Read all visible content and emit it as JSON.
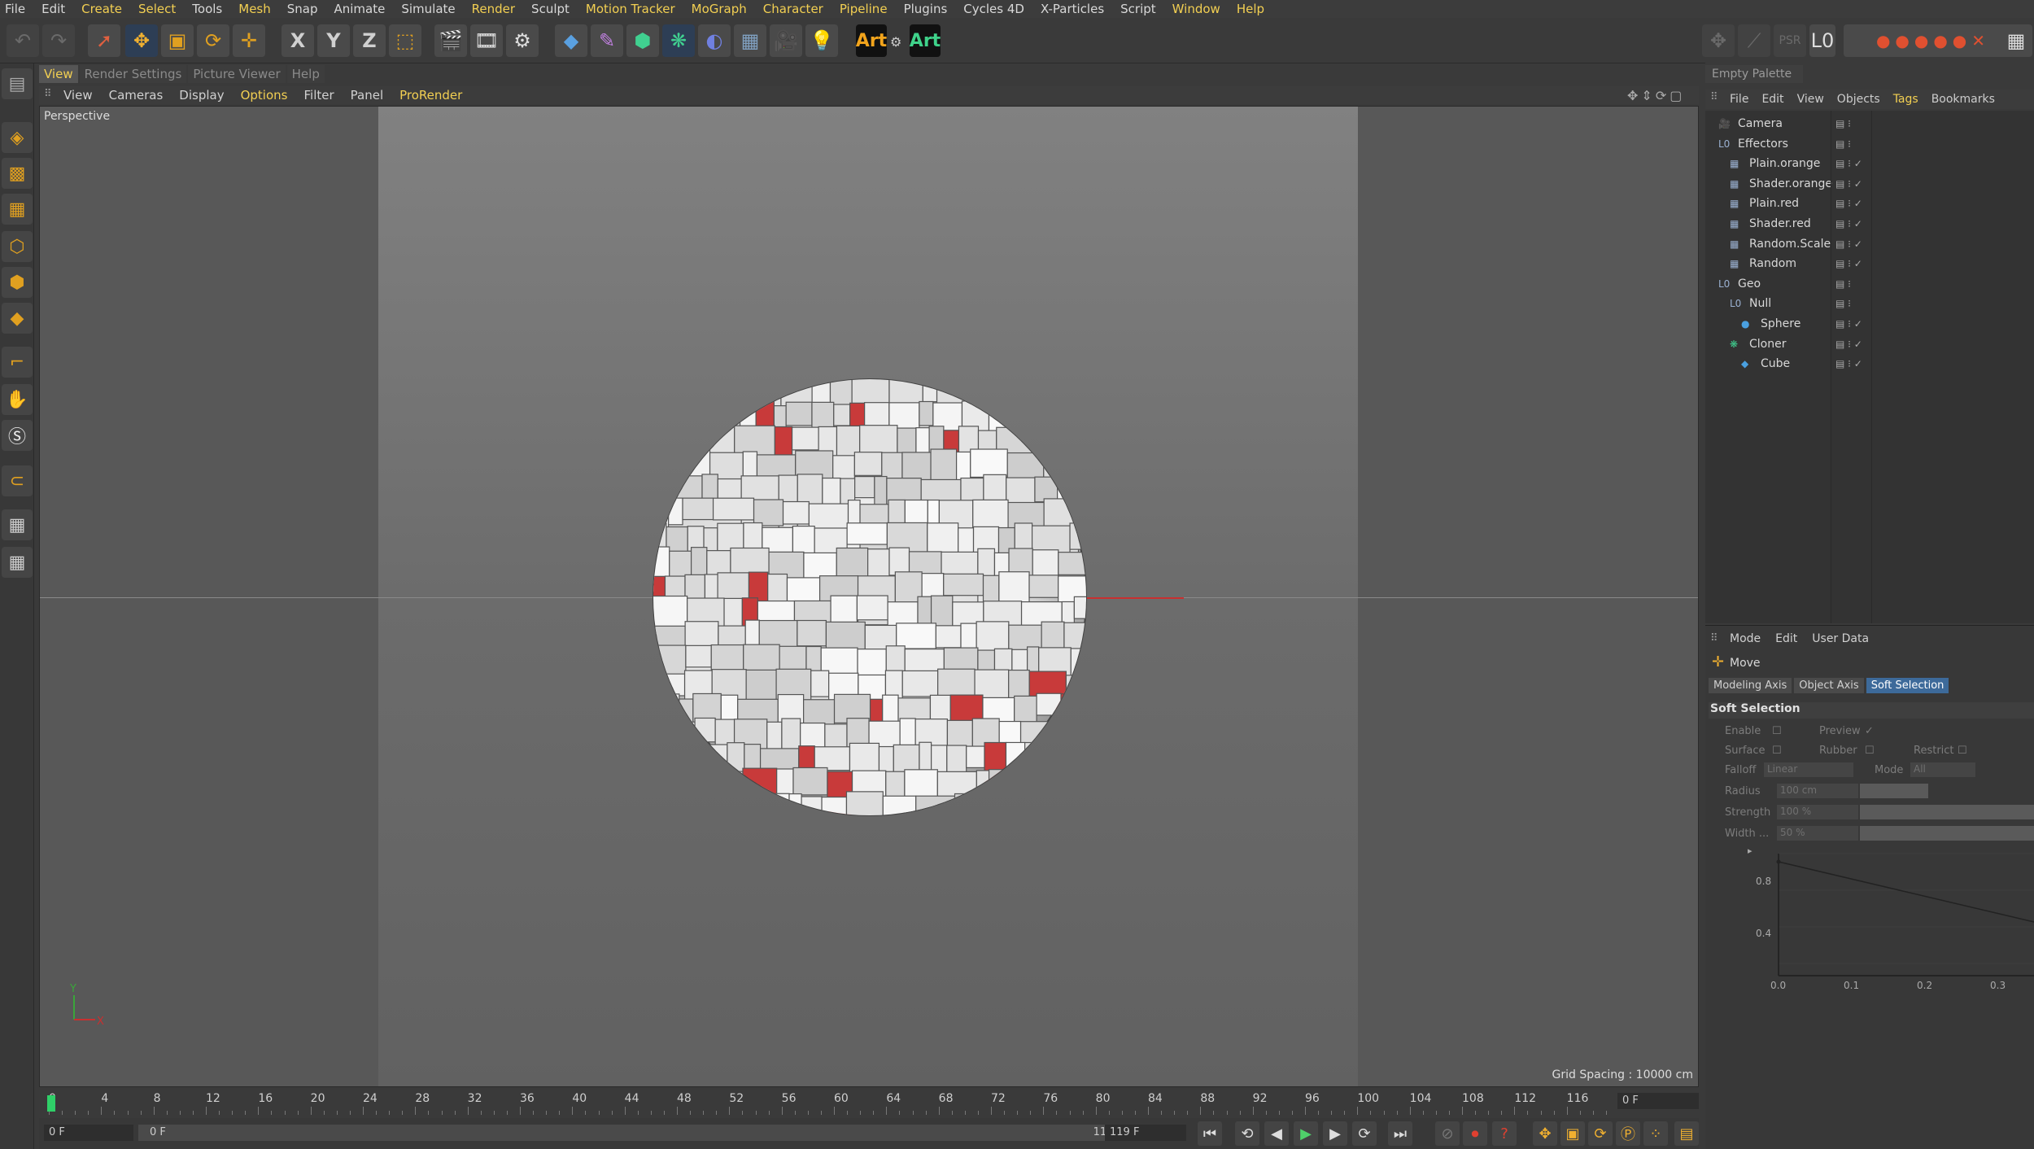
{
  "menubar": [
    "File",
    "Edit",
    "Create",
    "Select",
    "Tools",
    "Mesh",
    "Snap",
    "Animate",
    "Simulate",
    "Render",
    "Sculpt",
    "Motion Tracker",
    "MoGraph",
    "Character",
    "Pipeline",
    "Plugins",
    "Cycles 4D",
    "X-Particles",
    "Script",
    "Window",
    "Help"
  ],
  "menubar_highlight": [
    "Create",
    "Select",
    "Mesh",
    "Render",
    "Motion Tracker",
    "MoGraph",
    "Character",
    "Pipeline",
    "Window",
    "Help"
  ],
  "toolbar": {
    "x_label": "X",
    "y_label": "Y",
    "z_label": "Z",
    "art1": "Art",
    "art2": "Art"
  },
  "viewport_tabs": [
    "View",
    "Render Settings",
    "Picture Viewer",
    "Help"
  ],
  "viewport_menu": [
    "View",
    "Cameras",
    "Display",
    "Options",
    "Filter",
    "Panel",
    "ProRender"
  ],
  "viewport": {
    "label": "Perspective",
    "grid_spacing": "Grid Spacing : 10000 cm",
    "axis_y": "Y",
    "axis_x": "X"
  },
  "timeline": {
    "ticks": [
      "0",
      "4",
      "8",
      "12",
      "16",
      "20",
      "24",
      "28",
      "32",
      "36",
      "40",
      "44",
      "48",
      "52",
      "56",
      "60",
      "64",
      "68",
      "72",
      "76",
      "80",
      "84",
      "88",
      "92",
      "96",
      "100",
      "104",
      "108",
      "112",
      "116"
    ],
    "current_frame": "0 F"
  },
  "transport": {
    "start": "0 F",
    "range_start": "0 F",
    "range_end": "119 F",
    "end": "119 F"
  },
  "right_panel": {
    "empty_palette": "Empty Palette",
    "om_menu": [
      "File",
      "Edit",
      "View",
      "Objects",
      "Tags",
      "Bookmarks"
    ],
    "objects": [
      {
        "name": "Camera",
        "indent": 0
      },
      {
        "name": "Effectors",
        "indent": 0
      },
      {
        "name": "Plain.orange",
        "indent": 1
      },
      {
        "name": "Shader.orange",
        "indent": 1
      },
      {
        "name": "Plain.red",
        "indent": 1
      },
      {
        "name": "Shader.red",
        "indent": 1
      },
      {
        "name": "Random.Scale",
        "indent": 1
      },
      {
        "name": "Random",
        "indent": 1
      },
      {
        "name": "Geo",
        "indent": 0
      },
      {
        "name": "Null",
        "indent": 1
      },
      {
        "name": "Sphere",
        "indent": 2
      },
      {
        "name": "Cloner",
        "indent": 1
      },
      {
        "name": "Cube",
        "indent": 2
      }
    ]
  },
  "attributes": {
    "menu": [
      "Mode",
      "Edit",
      "User Data"
    ],
    "tool": "Move",
    "tabs": [
      "Modeling Axis",
      "Object Axis",
      "Soft Selection"
    ],
    "section": "Soft Selection",
    "enable": "Enable",
    "preview": "Preview",
    "surface": "Surface",
    "rubber": "Rubber",
    "restrict": "Restrict",
    "falloff": "Falloff",
    "falloff_value": "Linear",
    "mode": "Mode",
    "mode_value": "All",
    "radius": "Radius",
    "radius_value": "100 cm",
    "strength": "Strength",
    "strength_value": "100 %",
    "width": "Width ...",
    "width_value": "50 %",
    "graph_y": [
      "0.8",
      "0.4"
    ],
    "graph_x": [
      "0.0",
      "0.1",
      "0.2",
      "0.3"
    ]
  }
}
